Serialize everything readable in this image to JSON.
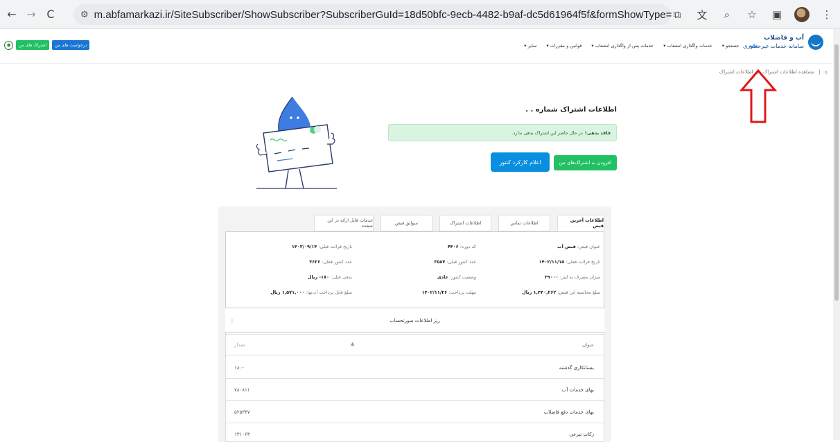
{
  "browser": {
    "url": "m.abfamarkazi.ir/SiteSubscriber/ShowSubscriber?SubscriberGuId=18d50bfc-9ecb-4482-b9af-dc5d61964f5f&formShowType="
  },
  "header": {
    "logo_title": "آب و فاضلاب",
    "logo_subtitle": "سامانه خدمات غیرحضوری",
    "nav": [
      "خانه",
      "جستجو ▾",
      "خدمات واگذاری انشعاب ▾",
      "خدمات پس از واگذاری انشعاب ▾",
      "قوانین و مقررات ▾",
      "سایر ▾"
    ],
    "btn_subscriptions": "اشتراک های من",
    "btn_requests": "درخواست های من"
  },
  "breadcrumb": {
    "home_icon": "home-icon",
    "item1": "مشاهده اطلاعات اشتراک",
    "sep": "|",
    "item2": "اطلاعات اشتراک"
  },
  "main": {
    "title": "اطلاعات اشتراک شماره   . .",
    "alert_bold": "فاقد بدهی!",
    "alert_text": "در حال حاضر این اشتراک بدهی ندارد.",
    "btn_add": "افزودن به اشتراک‌های من",
    "btn_meter": "اعلام کارکرد کنتور"
  },
  "tabs": [
    "اطلاعات آخرین قبض",
    "اطلاعات تماس",
    "اطلاعات اشتراک",
    "سوابق قبض",
    "خدمات قابل ارائه در این صفحه"
  ],
  "bill": {
    "col1": [
      {
        "k": "عنوان قبض:",
        "v": "قبض آب"
      },
      {
        "k": "تاریخ قرائت فعلی:",
        "v": "۱۴۰۲/۱۱/۱۵"
      },
      {
        "k": "میزان مصرف به لیتر:",
        "v": "۳۹۰۰۰"
      },
      {
        "k": "مبلغ محاسبه این قبض:",
        "v": "۱,۴۴۰,۲۶۲ ریال"
      }
    ],
    "col2": [
      {
        "k": "کد دوره:",
        "v": "۴۴۰۶"
      },
      {
        "k": "عدد کنتور قبلی:",
        "v": "۳۵۸۷"
      },
      {
        "k": "وضعیت کنتور:",
        "v": "عادی"
      },
      {
        "k": "مهلت پرداخت:",
        "v": "۱۴۰۲/۱۱/۲۶"
      }
    ],
    "col3": [
      {
        "k": "تاریخ قرائت قبلی:",
        "v": "۱۴۰۲/۰۹/۱۴"
      },
      {
        "k": "عدد کنتور فعلی:",
        "v": "۳۶۲۶"
      },
      {
        "k": "بدهی قبلی:",
        "v": "۱۸۰- ریال"
      },
      {
        "k": "مبلغ قابل پرداخت آب‌بها:",
        "v": "۱,۵۷۱,۰۰۰ ریال"
      }
    ]
  },
  "detail": {
    "title": "ریز اطلاعات صورتحساب",
    "col_title": "عنوان",
    "col_amount": "مقدار",
    "rows": [
      {
        "label": "بستانکاری گذشته",
        "value": "۱۸۰-"
      },
      {
        "label": "بهای خدمات آب",
        "value": "۷۸۰۸۱۱"
      },
      {
        "label": "بهای خدمات دفع فاضلاب",
        "value": "۵۲۵۳۴۷"
      },
      {
        "label": "زکات تبرعی",
        "value": "۱۳۱۰۶۳"
      }
    ]
  }
}
